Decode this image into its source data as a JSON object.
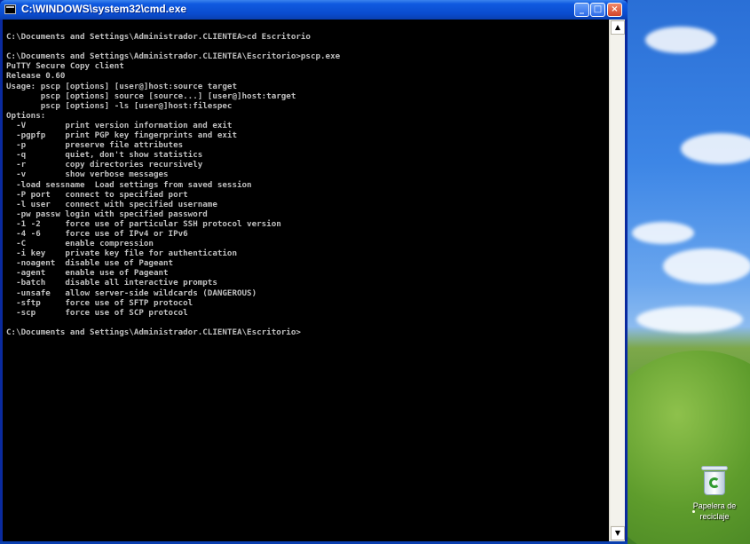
{
  "window": {
    "title": "C:\\WINDOWS\\system32\\cmd.exe",
    "minimize_glyph": "_",
    "maximize_glyph": "□",
    "close_glyph": "×"
  },
  "scrollbar": {
    "up_glyph": "▲",
    "down_glyph": "▼"
  },
  "console": {
    "lines": [
      "",
      "C:\\Documents and Settings\\Administrador.CLIENTEA>cd Escritorio",
      "",
      "C:\\Documents and Settings\\Administrador.CLIENTEA\\Escritorio>pscp.exe",
      "PuTTY Secure Copy client",
      "Release 0.60",
      "Usage: pscp [options] [user@]host:source target",
      "       pscp [options] source [source...] [user@]host:target",
      "       pscp [options] -ls [user@]host:filespec",
      "Options:",
      "  -V        print version information and exit",
      "  -pgpfp    print PGP key fingerprints and exit",
      "  -p        preserve file attributes",
      "  -q        quiet, don't show statistics",
      "  -r        copy directories recursively",
      "  -v        show verbose messages",
      "  -load sessname  Load settings from saved session",
      "  -P port   connect to specified port",
      "  -l user   connect with specified username",
      "  -pw passw login with specified password",
      "  -1 -2     force use of particular SSH protocol version",
      "  -4 -6     force use of IPv4 or IPv6",
      "  -C        enable compression",
      "  -i key    private key file for authentication",
      "  -noagent  disable use of Pageant",
      "  -agent    enable use of Pageant",
      "  -batch    disable all interactive prompts",
      "  -unsafe   allow server-side wildcards (DANGEROUS)",
      "  -sftp     force use of SFTP protocol",
      "  -scp      force use of SCP protocol",
      "",
      "C:\\Documents and Settings\\Administrador.CLIENTEA\\Escritorio>"
    ]
  },
  "desktop": {
    "recycle_bin_label": "Papelera de reciclaje"
  }
}
